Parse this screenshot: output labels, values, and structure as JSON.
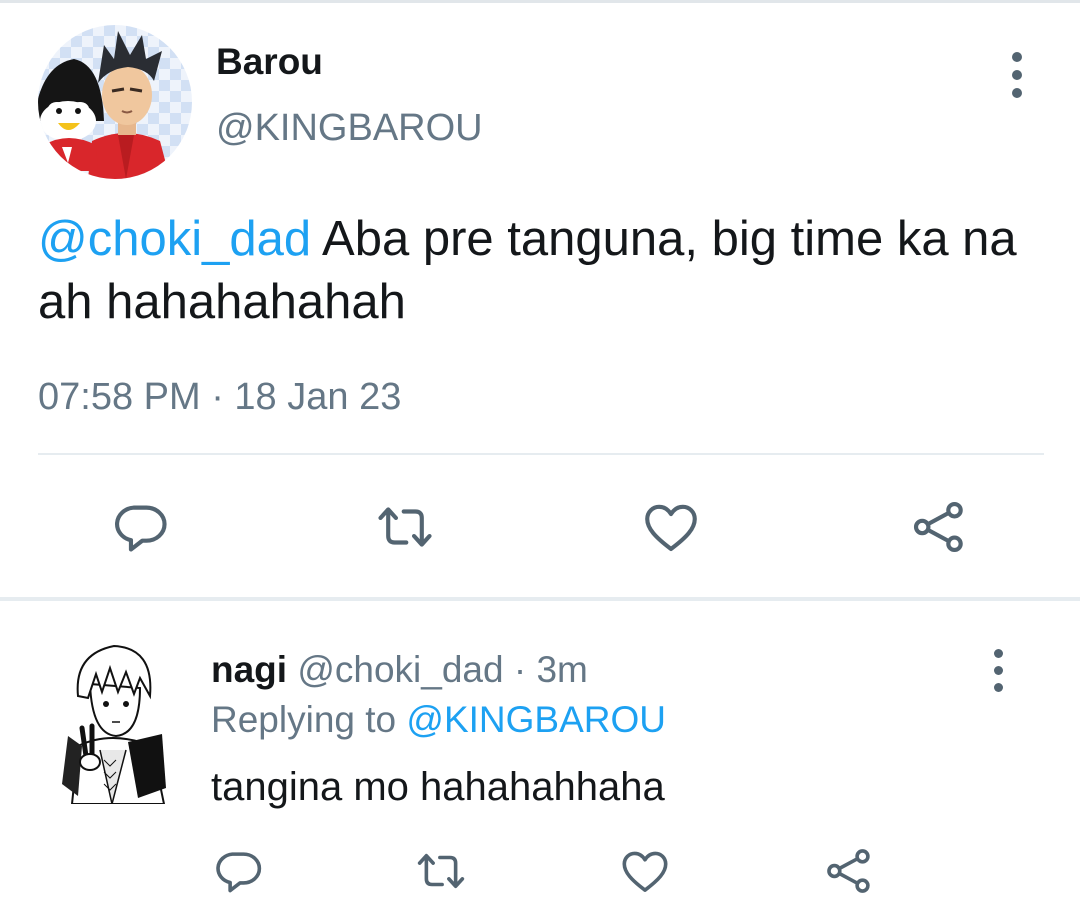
{
  "main_tweet": {
    "display_name": "Barou",
    "handle": "@KINGBAROU",
    "mention": "@choki_dad",
    "text": " Aba pre tanguna, big time ka na ah hahahahahah",
    "timestamp": "07:58 PM · 18 Jan 23",
    "avatar_icon": "profile-avatar-barou"
  },
  "reply_tweet": {
    "display_name": "nagi",
    "meta": " @choki_dad · 3m",
    "replying_prefix": "Replying to ",
    "replying_handle": "@KINGBAROU",
    "text": "tangina mo hahahahhaha",
    "avatar_icon": "profile-avatar-nagi"
  },
  "actions": [
    "reply-icon",
    "retweet-icon",
    "like-icon",
    "share-icon"
  ],
  "colors": {
    "text": "#14171a",
    "secondary": "#657786",
    "link": "#1da1f2",
    "icon": "#536471",
    "divider": "#e6ecf0"
  }
}
